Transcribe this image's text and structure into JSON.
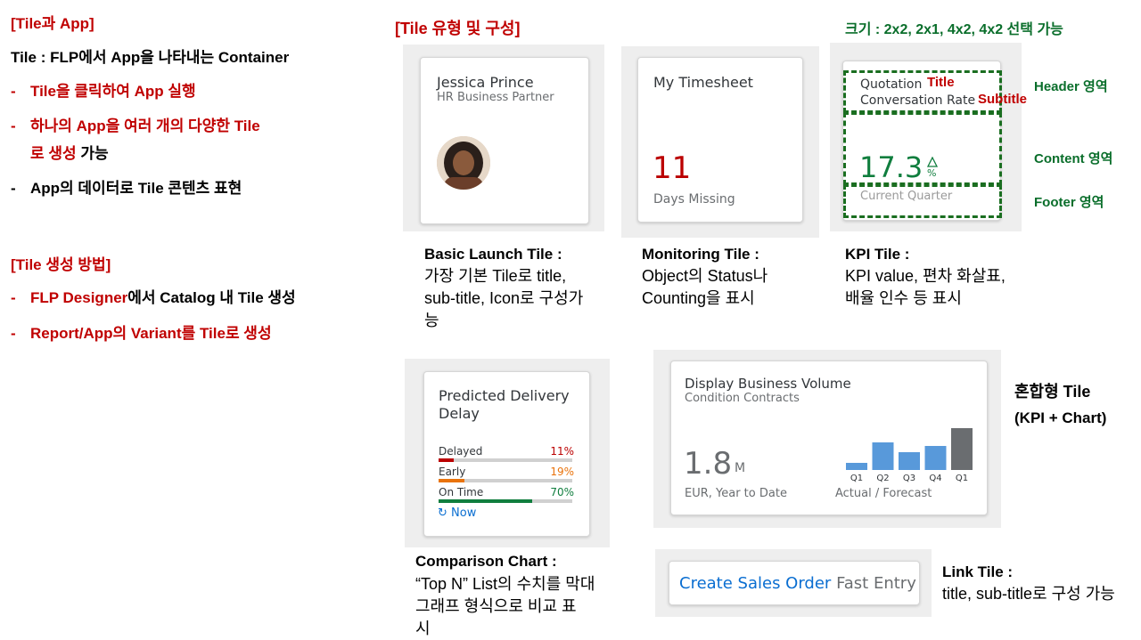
{
  "left": {
    "section1_title": "[Tile과 App]",
    "tile_def_prefix": "Tile : FLP에서 App을 나타내는 Container",
    "bullets1": [
      {
        "red": "Tile을 클릭하여 App 실행",
        "black": ""
      },
      {
        "red": "하나의 App을 여러 개의 다양한 Tile",
        "black": ""
      },
      {
        "red": "로 생성",
        "black": " 가능"
      },
      {
        "red": "",
        "black": "App의 데이터로 Tile 콘텐츠 표현"
      }
    ],
    "section2_title": "[Tile 생성 방법]",
    "bullets2": [
      {
        "red": "FLP Designer",
        "black": "에서 Catalog 내 Tile 생성"
      },
      {
        "red": "Report/App의 Variant를 Tile로 생성",
        "black": ""
      }
    ],
    "dash": "-"
  },
  "types_title": "[Tile 유형 및 구성]",
  "size_title": "크기 : 2x2, 2x1, 4x2, 4x2 선택 가능",
  "basic_tile": {
    "name": "Jessica Prince",
    "role": "HR Business Partner",
    "caption_head": "Basic Launch Tile :",
    "caption_lines": [
      "가장 기본 Tile로 title,",
      "sub-title, Icon로 구성가",
      "능"
    ]
  },
  "monitor_tile": {
    "title": "My Timesheet",
    "value": "11",
    "footer": "Days Missing",
    "caption_head": "Monitoring Tile :",
    "caption_lines": [
      "Object의 Status나",
      "Counting을 표시"
    ]
  },
  "kpi_tile": {
    "title": "Quotation",
    "subtitle": "Conversation Rate",
    "value": "17.3",
    "unit": "%",
    "trend_icon": "triangle-up-icon",
    "footer": "Current Quarter",
    "ann_title": "Title",
    "ann_subtitle": "Subtitle",
    "regions": [
      "Header 영역",
      "Content 영역",
      "Footer 영역"
    ],
    "caption_head": "KPI Tile :",
    "caption_lines": [
      "KPI value, 편차 화살표,",
      "배율 인수 등 표시"
    ]
  },
  "comparison_tile": {
    "title_lines": [
      "Predicted Delivery",
      "Delay"
    ],
    "rows": [
      {
        "label": "Delayed",
        "pct": "11%",
        "fraction": 0.11,
        "color": "#bb0000"
      },
      {
        "label": "Early",
        "pct": "19%",
        "fraction": 0.19,
        "color": "#e9730c"
      },
      {
        "label": "On Time",
        "pct": "70%",
        "fraction": 0.7,
        "color": "#107e3e"
      }
    ],
    "refresh": "Now",
    "caption_head": "Comparison Chart :",
    "caption_lines": [
      "“Top N” List의 수치를 막대",
      "그래프 형식으로 비교 표",
      "시"
    ]
  },
  "combo_tile": {
    "title": "Display Business Volume",
    "subtitle": "Condition Contracts",
    "value": "1.8",
    "scale": "M",
    "footer_left": "EUR, Year to Date",
    "footer_right": "Actual / Forecast",
    "label_line1": "혼합형 Tile",
    "label_line2": "(KPI + Chart)"
  },
  "chart_data": {
    "type": "bar",
    "categories": [
      "Q1",
      "Q2",
      "Q3",
      "Q4",
      "Q1"
    ],
    "values": [
      2,
      8,
      5,
      7,
      12
    ],
    "colors": [
      "#5899da",
      "#5899da",
      "#5899da",
      "#5899da",
      "#6a6d70"
    ],
    "title": "",
    "xlabel": "",
    "ylabel": ""
  },
  "link_tile": {
    "title": "Create Sales Order",
    "subtitle": "Fast Entry",
    "caption_head": "Link Tile :",
    "caption_body": "title, sub-title로 구성 가능"
  }
}
